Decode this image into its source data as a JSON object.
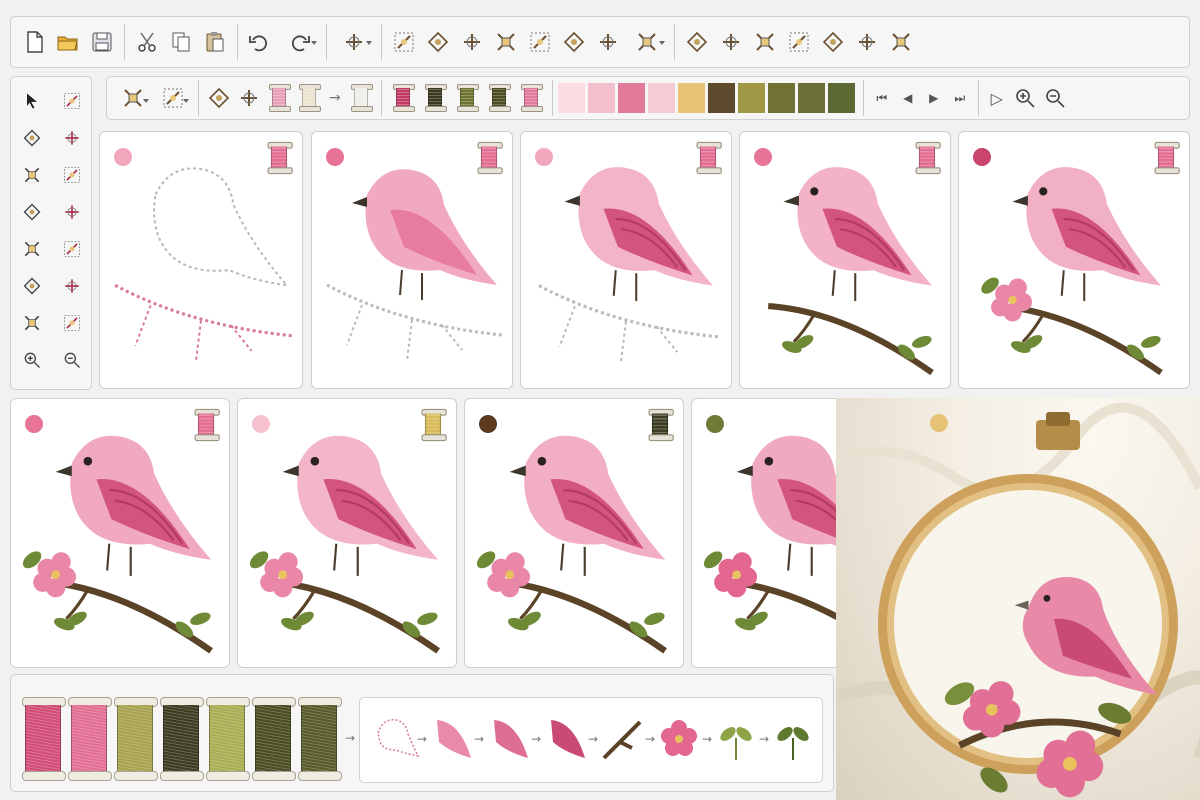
{
  "toolbar": {
    "items": [
      {
        "name": "new-file-icon",
        "kind": "btn"
      },
      {
        "name": "open-folder-icon",
        "kind": "btn"
      },
      {
        "name": "save-icon",
        "kind": "btn"
      },
      {
        "kind": "sep"
      },
      {
        "name": "cut-icon",
        "kind": "btn"
      },
      {
        "name": "copy-icon",
        "kind": "btn"
      },
      {
        "name": "paste-icon",
        "kind": "btn"
      },
      {
        "kind": "sep"
      },
      {
        "name": "undo-icon",
        "kind": "btn"
      },
      {
        "name": "redo-icon",
        "kind": "dd"
      },
      {
        "kind": "sep"
      },
      {
        "name": "stitch-simulator-icon",
        "kind": "dd"
      },
      {
        "kind": "sep"
      },
      {
        "name": "stitch-tool-1-icon",
        "kind": "btn"
      },
      {
        "name": "stitch-tool-2-icon",
        "kind": "btn"
      },
      {
        "name": "stitch-tool-3-icon",
        "kind": "btn"
      },
      {
        "name": "stitch-tool-4-icon",
        "kind": "btn"
      },
      {
        "name": "stitch-tool-5-icon",
        "kind": "btn"
      },
      {
        "name": "stitch-tool-6-icon",
        "kind": "btn"
      },
      {
        "name": "stitch-tool-7-icon",
        "kind": "btn"
      },
      {
        "name": "stitch-tool-8-icon",
        "kind": "dd"
      },
      {
        "kind": "sep"
      },
      {
        "name": "layout-tool-1-icon",
        "kind": "btn"
      },
      {
        "name": "layout-tool-2-icon",
        "kind": "btn"
      },
      {
        "name": "layout-tool-3-icon",
        "kind": "btn"
      },
      {
        "name": "layout-tool-4-icon",
        "kind": "btn"
      },
      {
        "name": "layout-tool-5-icon",
        "kind": "btn"
      },
      {
        "name": "layout-tool-6-icon",
        "kind": "btn"
      },
      {
        "name": "layout-tool-7-icon",
        "kind": "btn"
      }
    ]
  },
  "left_tools": [
    "select-arrow-icon",
    "magic-wand-icon",
    "pen-icon",
    "eyedropper-icon",
    "curve-tool-icon",
    "gauge-tool-icon",
    "zoom-region-icon",
    "leaf-shape-icon",
    "frame-tool-icon",
    "transform-tool-icon",
    "fill-tool-icon",
    "node-tool-icon",
    "lasso-tool-icon",
    "resize-tool-icon",
    "zoom-in-icon",
    "zoom-fit-icon"
  ],
  "format_toolbar": {
    "spools": [
      "#e8a0b8",
      "#ece4cf",
      "#efefe8",
      "#c43c66",
      "#3b3a20",
      "#6e7431",
      "#4b4c22",
      "#e27a9d"
    ],
    "swatches": [
      "#f9dde3",
      "#f4bfcc",
      "#e27a99",
      "#f6cbd4",
      "#e6c277",
      "#5e4a2c",
      "#9e9847",
      "#6f7234",
      "#6c7037",
      "#5b6832"
    ]
  },
  "steps": [
    {
      "dot": "#f2a6bb",
      "spool": "#e46e92"
    },
    {
      "dot": "#e77497",
      "spool": "#e46e92"
    },
    {
      "dot": "#f2a6bb",
      "spool": "#e46e92"
    },
    {
      "dot": "#e77497",
      "spool": "#e46e92"
    },
    {
      "dot": "#c9456c",
      "spool": "#e46e92"
    },
    {
      "dot": "#e77497",
      "spool": "#e46e92"
    },
    {
      "dot": "#f6c1cd",
      "spool": "#d8bb58"
    },
    {
      "dot": "#5b3a22",
      "spool": "#3f3e22"
    },
    {
      "dot": "#6e7a36",
      "spool": "#3f3e22"
    },
    {
      "dot": "#e6c277"
    }
  ],
  "palette_spools": [
    "#d24c78",
    "#e26e93",
    "#a8a24e",
    "#3d3b20",
    "#a8ad52",
    "#4a4c22",
    "#585a2a"
  ],
  "sequence_steps": [
    "outline",
    "wing-light",
    "wing-mid",
    "wing-dark",
    "branch",
    "flower",
    "leaf-light",
    "leaf-dark"
  ]
}
